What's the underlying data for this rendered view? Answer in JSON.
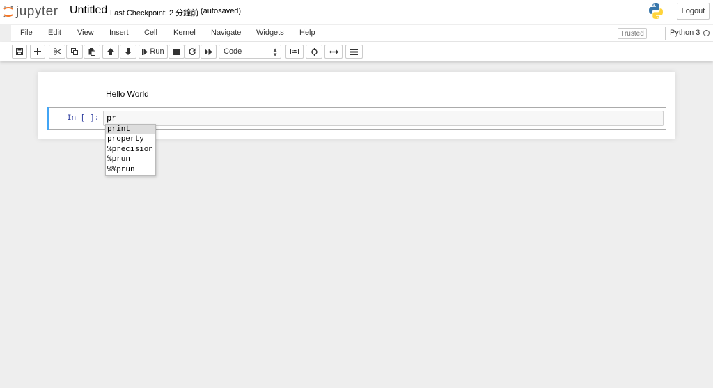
{
  "header": {
    "logo_text": "jupyter",
    "notebook_name": "Untitled",
    "checkpoint": "Last Checkpoint: 2 分鐘前",
    "autosave": "(autosaved)",
    "logout_label": "Logout"
  },
  "menubar": {
    "items": [
      "File",
      "Edit",
      "View",
      "Insert",
      "Cell",
      "Kernel",
      "Navigate",
      "Widgets",
      "Help"
    ],
    "trusted_label": "Trusted",
    "kernel_name": "Python 3"
  },
  "toolbar": {
    "run_label": "Run",
    "cell_type": "Code",
    "icons": [
      "save-icon",
      "plus-icon",
      "cut-icon",
      "copy-icon",
      "paste-icon",
      "arrow-up-icon",
      "arrow-down-icon",
      "step-forward-icon",
      "stop-icon",
      "restart-icon",
      "fast-forward-icon",
      "keyboard-icon",
      "crosshairs-icon",
      "arrows-h-icon",
      "list-icon"
    ]
  },
  "notebook": {
    "markdown_output": "Hello World",
    "prompt": "In [ ]:",
    "code": "pr",
    "completions": [
      "print",
      "property",
      "%precision",
      "%prun",
      "%%prun"
    ],
    "selected_completion": 0
  },
  "colors": {
    "accent_selected_cell": "#42a5f5",
    "prompt_color": "#303f9f"
  }
}
